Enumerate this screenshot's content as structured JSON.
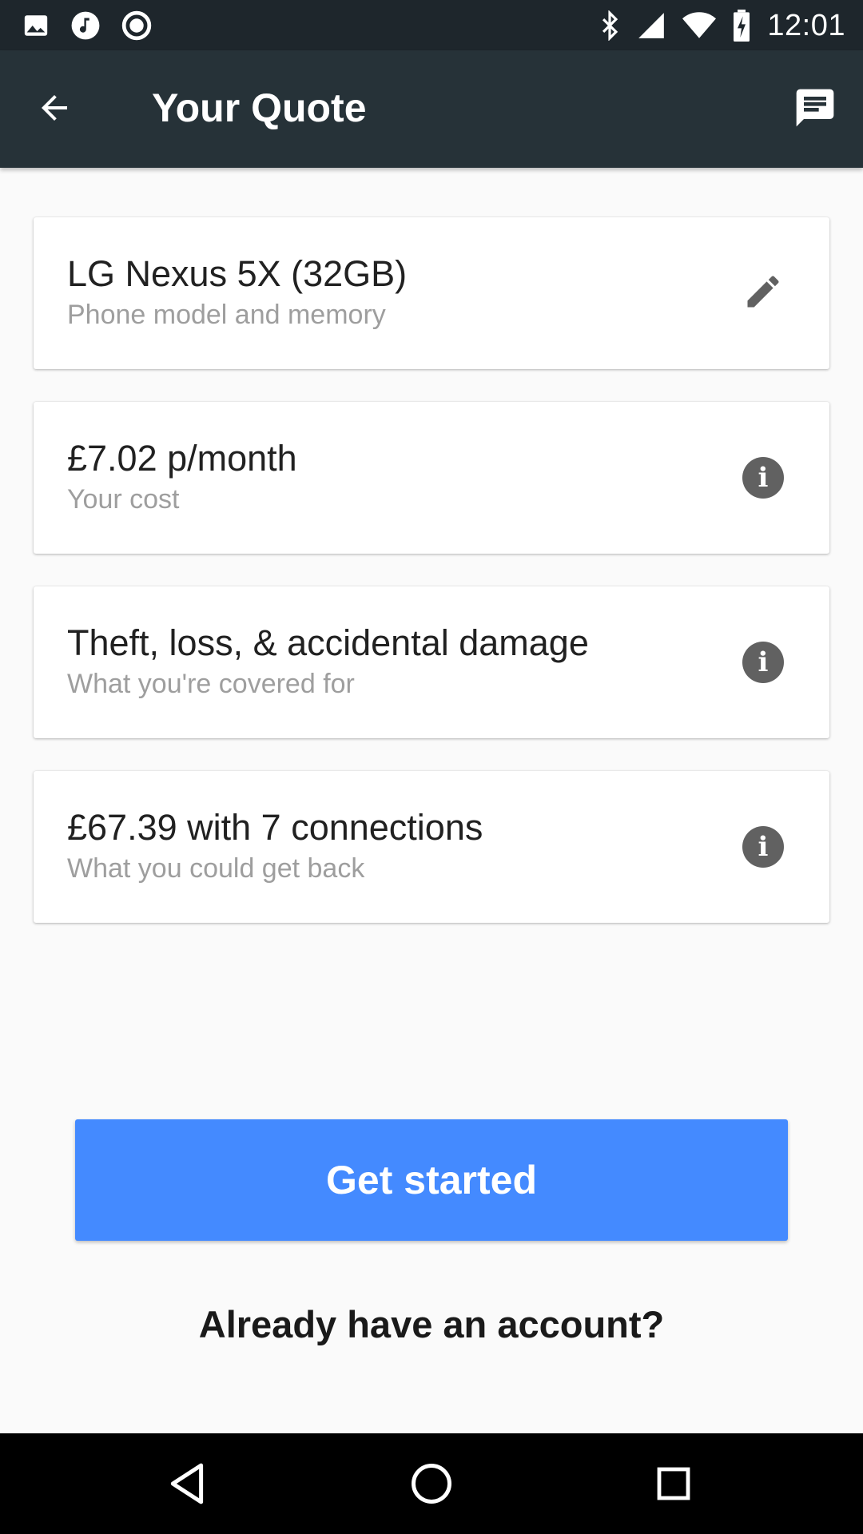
{
  "status_bar": {
    "time": "12:01",
    "left_icons": [
      "image-icon",
      "music-icon",
      "record-icon"
    ],
    "right_icons": [
      "bluetooth-icon",
      "cell-signal-icon",
      "wifi-icon",
      "battery-charging-icon"
    ]
  },
  "app_bar": {
    "title": "Your Quote",
    "back_icon": "arrow-back-icon",
    "action_icon": "chat-icon"
  },
  "cards": [
    {
      "primary": "LG Nexus 5X (32GB)",
      "secondary": "Phone model and memory",
      "icon": "edit-icon"
    },
    {
      "primary": "£7.02 p/month",
      "secondary": "Your cost",
      "icon": "info-icon"
    },
    {
      "primary": "Theft, loss, & accidental damage",
      "secondary": "What you're covered for",
      "icon": "info-icon"
    },
    {
      "primary": "£67.39 with 7 connections",
      "secondary": "What you could get back",
      "icon": "info-icon"
    }
  ],
  "cta": {
    "label": "Get started"
  },
  "account_link": {
    "label": "Already have an account?"
  },
  "nav_bar": {
    "icons": [
      "back-triangle-icon",
      "home-circle-icon",
      "recents-square-icon"
    ]
  },
  "colors": {
    "status_bar": "#1e262c",
    "app_bar": "#263238",
    "background": "#fafafa",
    "primary_button": "#448aff",
    "icon_gray": "#616161"
  }
}
